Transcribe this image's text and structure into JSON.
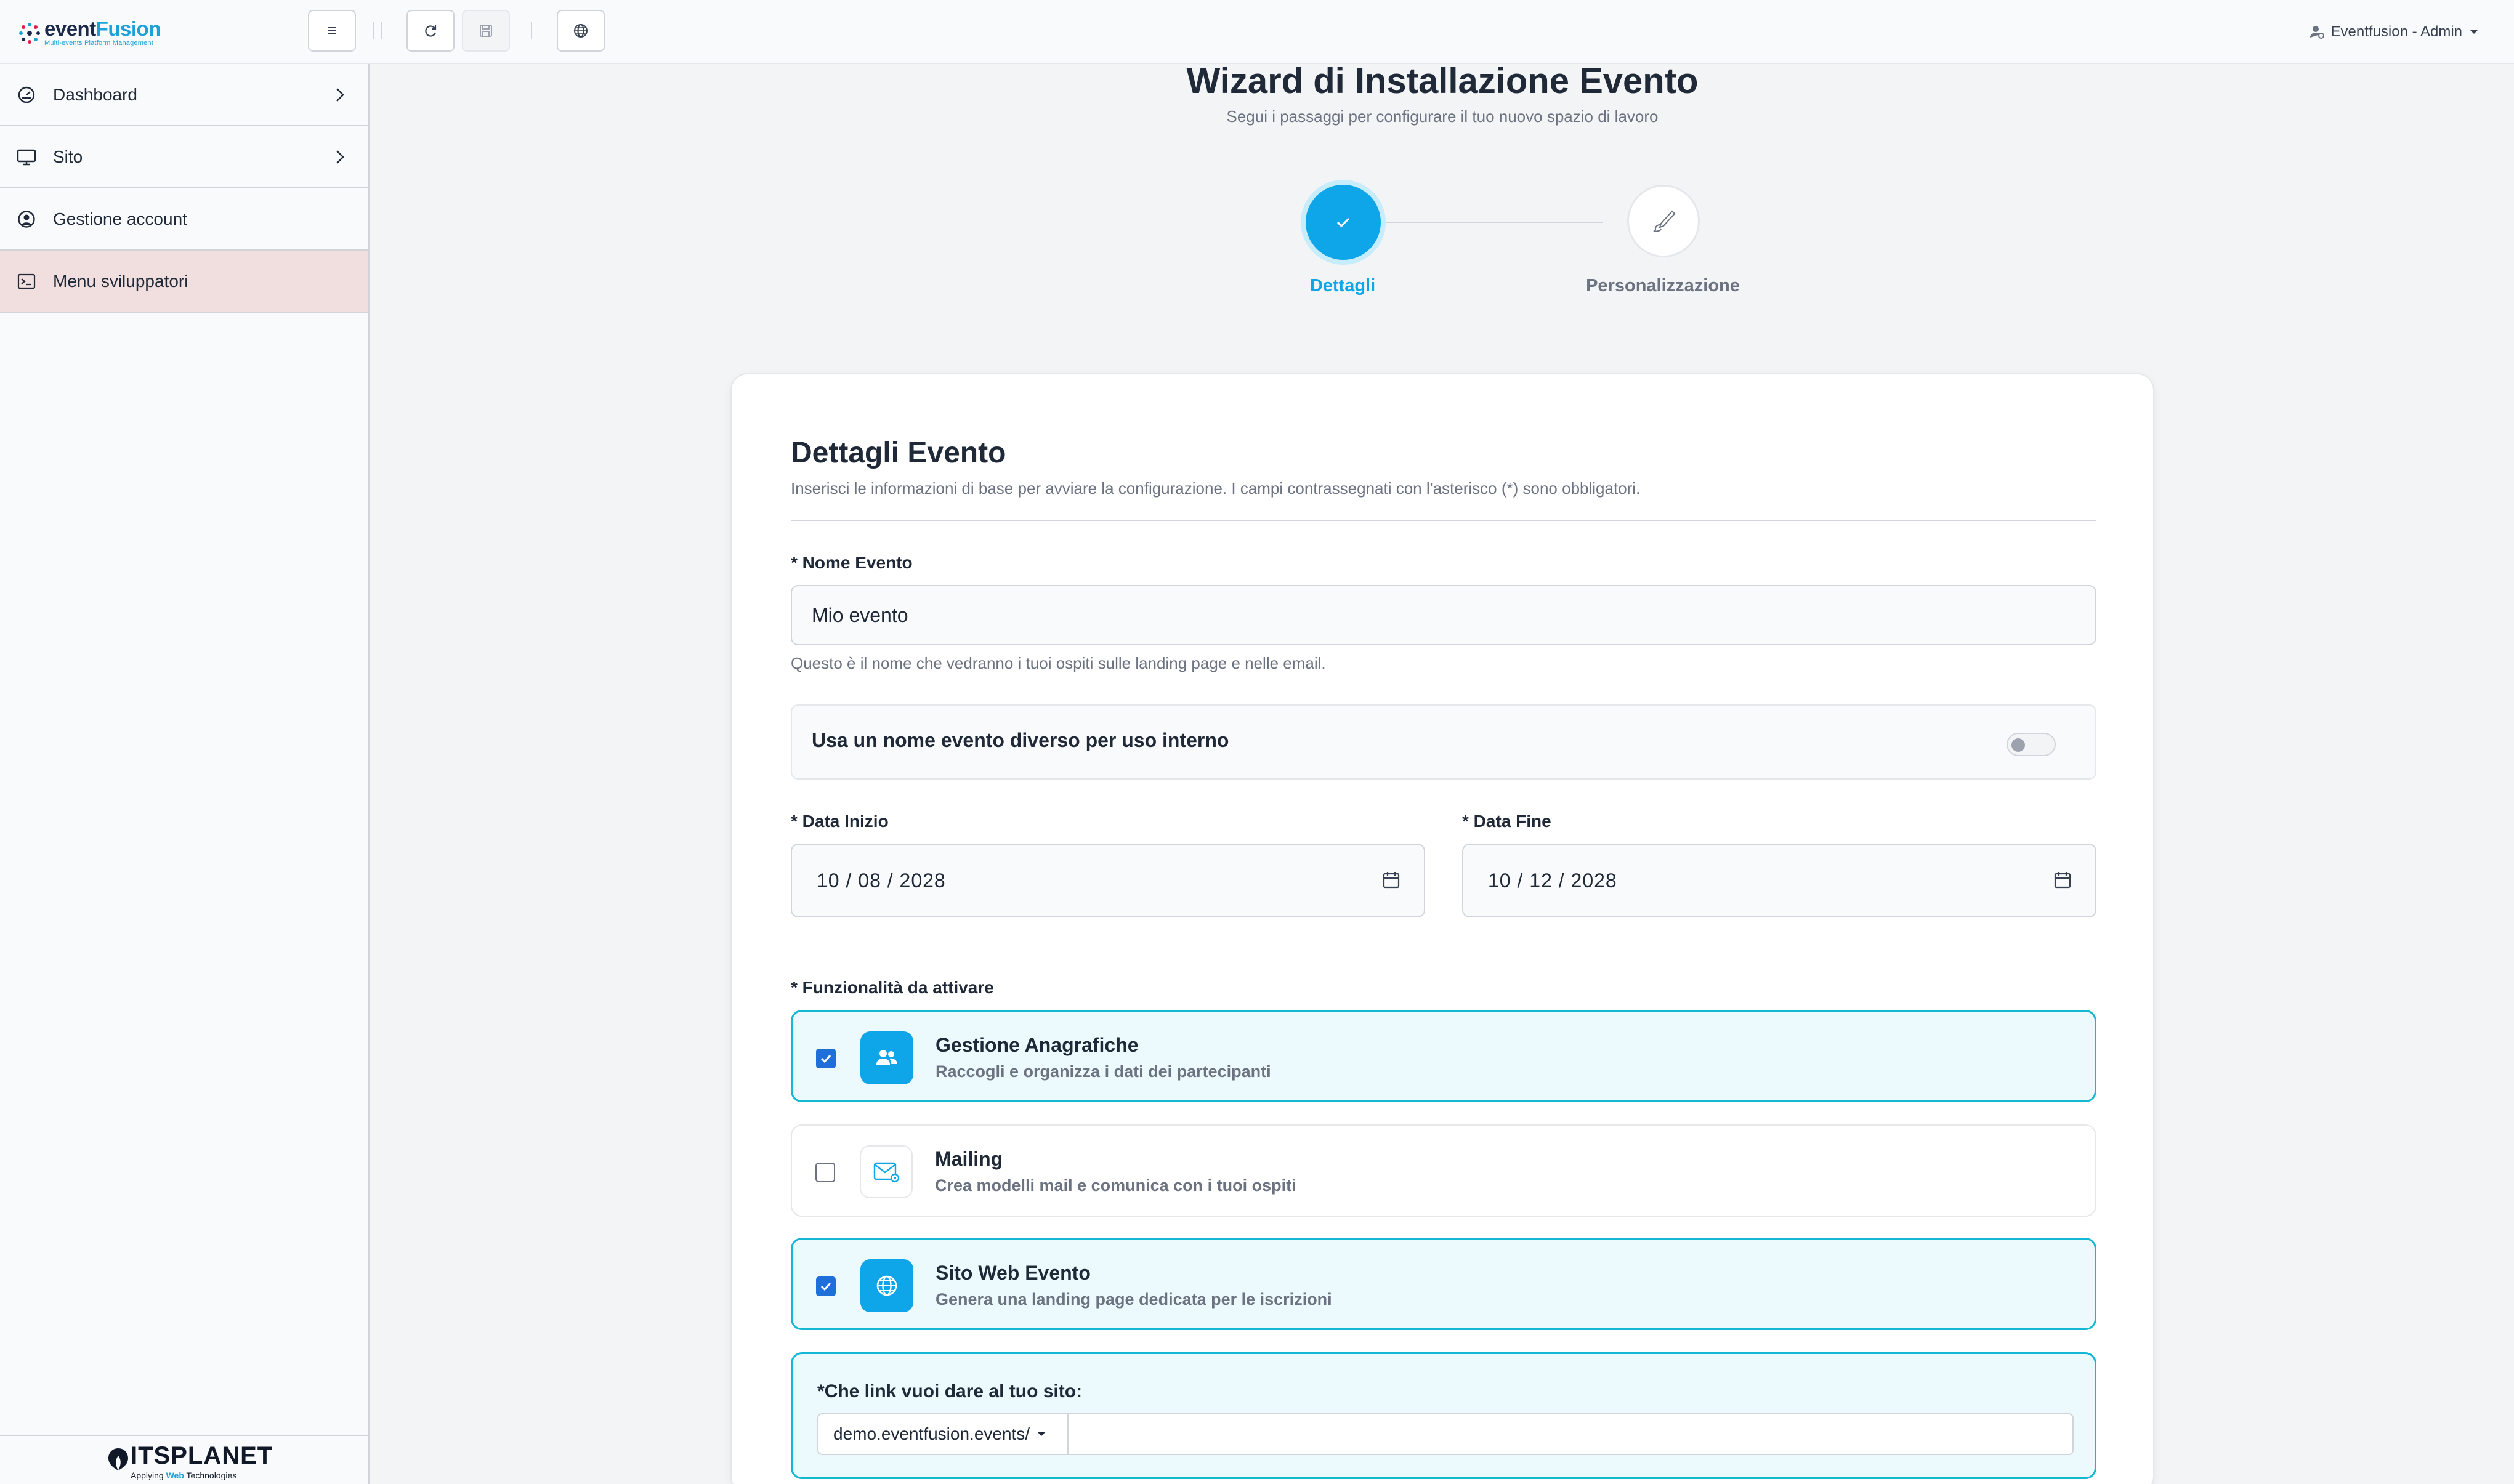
{
  "app": {
    "logo_part1": "event",
    "logo_part2": "Fusion",
    "logo_sub": "Multi-events Platform Management"
  },
  "toolbar": {
    "menu_icon": "menu-icon",
    "refresh_icon": "refresh-icon",
    "save_icon": "save-icon",
    "globe_icon": "globe-icon"
  },
  "user": {
    "label": "Eventfusion - Admin"
  },
  "sidebar": {
    "items": [
      {
        "label": "Dashboard",
        "icon": "gauge-icon",
        "has_chevron": true
      },
      {
        "label": "Sito",
        "icon": "monitor-icon",
        "has_chevron": true
      },
      {
        "label": "Gestione account",
        "icon": "user-circle-icon",
        "has_chevron": false
      },
      {
        "label": "Menu sviluppatori",
        "icon": "terminal-icon",
        "has_chevron": false,
        "active": true
      }
    ],
    "footer_logo": {
      "title": "ITSPLANET",
      "sub_a": "Applying ",
      "sub_b": "Web",
      "sub_c": " Technologies"
    }
  },
  "wizard": {
    "title": "Wizard di Installazione Evento",
    "subtitle": "Segui i passaggi per configurare il tuo nuovo spazio di lavoro",
    "steps": [
      {
        "label": "Dettagli",
        "state": "done"
      },
      {
        "label": "Personalizzazione",
        "state": "pending"
      }
    ]
  },
  "form": {
    "title": "Dettagli Evento",
    "description": "Inserisci le informazioni di base per avviare la configurazione. I campi contrassegnati con l'asterisco (*) sono obbligatori.",
    "event_name": {
      "label": "* Nome Evento",
      "value": "Mio evento",
      "help": "Questo è il nome che vedranno i tuoi ospiti sulle landing page e nelle email."
    },
    "internal_name_toggle": {
      "label": "Usa un nome evento diverso per uso interno",
      "checked": false
    },
    "start_date": {
      "label": "* Data Inizio",
      "value": "10 / 08 / 2028"
    },
    "end_date": {
      "label": "* Data Fine",
      "value": "10 / 12 / 2028"
    },
    "features_label": "* Funzionalità da attivare",
    "features": [
      {
        "title": "Gestione Anagrafiche",
        "subtitle": "Raccogli e organizza i dati dei partecipanti",
        "checked": true,
        "icon": "users-icon"
      },
      {
        "title": "Mailing",
        "subtitle": "Crea modelli mail e comunica con i tuoi ospiti",
        "checked": false,
        "icon": "mail-icon"
      },
      {
        "title": "Sito Web Evento",
        "subtitle": "Genera una landing page dedicata per le iscrizioni",
        "checked": true,
        "icon": "globe-icon"
      }
    ],
    "site_link": {
      "label": "*Che link vuoi dare al tuo sito:",
      "domain": "demo.eventfusion.events/",
      "slug": ""
    }
  },
  "colors": {
    "accent": "#0ea5e9",
    "active_sidebar": "#f1dedf",
    "feature_border": "#14b8d3",
    "checkbox": "#1e6fd9"
  }
}
